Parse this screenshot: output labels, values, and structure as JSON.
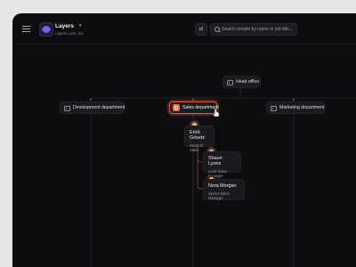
{
  "header": {
    "brand_name": "Layers",
    "brand_domain": "Layers.com, Inc.",
    "search_placeholder": "Search people by name or job title..."
  },
  "org_chart": {
    "root": {
      "label": "Head office"
    },
    "departments": [
      {
        "label": "Development department"
      },
      {
        "label": "Sales department",
        "selected": true
      },
      {
        "label": "Marketing department"
      }
    ],
    "people": [
      {
        "name": "Erick Grisetz",
        "role": "Head of Sales"
      },
      {
        "name": "Shaun Lyons",
        "role": "Lead Sales Manager"
      },
      {
        "name": "Nora Morgan",
        "role": "Senior Sales Manager"
      }
    ]
  },
  "colors": {
    "accent": "#e45a3c",
    "background": "#0d0d10",
    "card": "#1b1b1f"
  }
}
